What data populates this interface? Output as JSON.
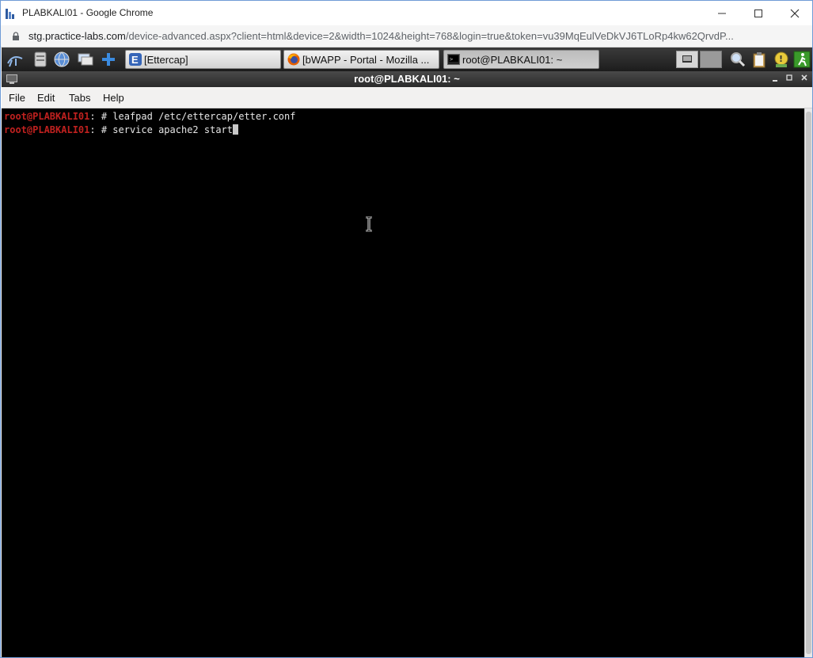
{
  "browser": {
    "window_title": "PLABKALI01 - Google Chrome",
    "url_host": "stg.practice-labs.com",
    "url_path": "/device-advanced.aspx?client=html&device=2&width=1024&height=768&login=true&token=vu39MqEulVeDkVJ6TLoRp4kw62QrvdP..."
  },
  "panel": {
    "tasks": [
      {
        "label": "[Ettercap]",
        "icon": "ettercap-icon"
      },
      {
        "label": "[bWAPP - Portal - Mozilla ...",
        "icon": "firefox-icon"
      },
      {
        "label": "root@PLABKALI01: ~",
        "icon": "terminal-icon"
      }
    ]
  },
  "terminal": {
    "title": "root@PLABKALI01: ~",
    "menu": [
      "File",
      "Edit",
      "Tabs",
      "Help"
    ],
    "lines": [
      {
        "user": "root@PLABKALI01",
        "rest": ": # leafpad /etc/ettercap/etter.conf"
      },
      {
        "user": "root@PLABKALI01",
        "rest": ": # service apache2 start"
      }
    ]
  },
  "colors": {
    "prompt_user": "#c0211f",
    "terminal_bg": "#000000",
    "terminal_fg": "#e5e5e5"
  }
}
